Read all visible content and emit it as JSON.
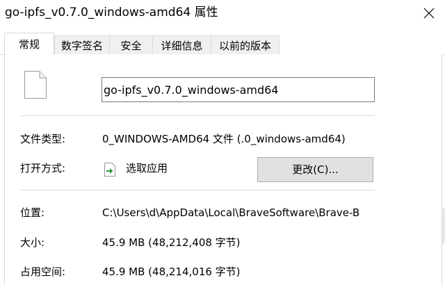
{
  "window": {
    "title": "go-ipfs_v0.7.0_windows-amd64 属性",
    "close_icon": "close-icon"
  },
  "tabs": [
    {
      "label": "常规",
      "active": true
    },
    {
      "label": "数字签名",
      "active": false
    },
    {
      "label": "安全",
      "active": false
    },
    {
      "label": "详细信息",
      "active": false
    },
    {
      "label": "以前的版本",
      "active": false
    }
  ],
  "general": {
    "file_icon": "file-icon",
    "file_name": "go-ipfs_v0.7.0_windows-amd64",
    "file_type_label": "文件类型:",
    "file_type_value": "0_WINDOWS-AMD64 文件 (.0_windows-amd64)",
    "opens_with_label": "打开方式:",
    "opens_with_icon": "choose-app-icon",
    "opens_with_value": "选取应用",
    "change_button": "更改(C)...",
    "location_label": "位置:",
    "location_value": "C:\\Users\\d\\AppData\\Local\\BraveSoftware\\Brave-B",
    "size_label": "大小:",
    "size_value": "45.9 MB (48,212,408 字节)",
    "size_on_disk_label": "占用空间:",
    "size_on_disk_value": "45.9 MB (48,214,016 字节)"
  },
  "colors": {
    "tab_inactive": "#f0f0f0",
    "button_face": "#e1e1e1",
    "border": "#d9d9d9",
    "green_arrow": "#2e9e3f"
  }
}
